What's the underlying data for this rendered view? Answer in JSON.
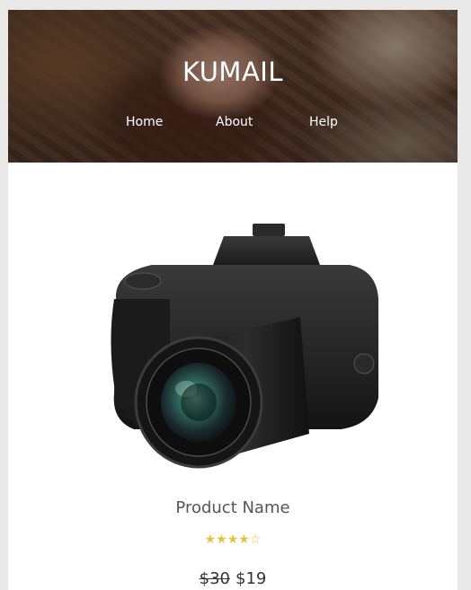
{
  "header": {
    "brand": "KUMAIL",
    "nav": [
      {
        "label": "Home"
      },
      {
        "label": "About"
      },
      {
        "label": "Help"
      }
    ]
  },
  "product": {
    "image_alt": "camera",
    "name": "Product Name",
    "rating": 4,
    "rating_max": 5,
    "rating_stars": "★★★★☆",
    "old_price": "$30",
    "new_price": "$19"
  },
  "colors": {
    "star": "#e2c33b",
    "text": "#555555",
    "page_bg": "#e9e9e9"
  }
}
